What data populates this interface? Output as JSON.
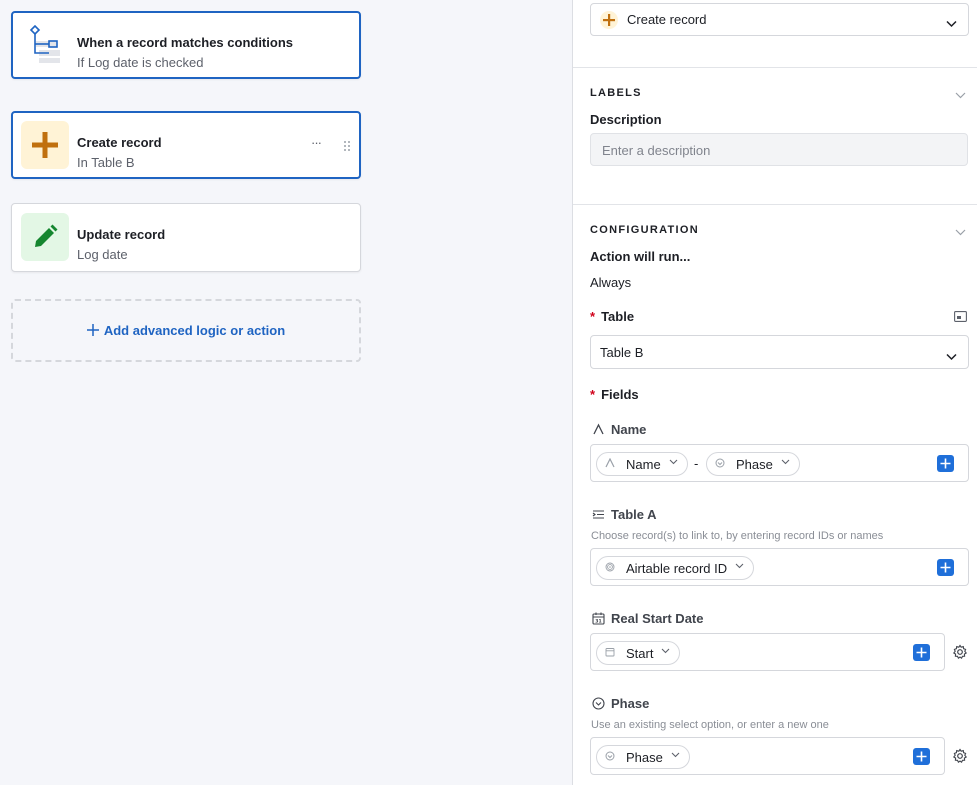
{
  "canvas": {
    "trigger": {
      "title": "When a record matches conditions",
      "subtitle": "If Log date is checked",
      "icon": "conditions-icon"
    },
    "actions": [
      {
        "title": "Create record",
        "subtitle": "In Table B",
        "icon": "plus-icon",
        "more": "···"
      },
      {
        "title": "Update record",
        "subtitle": "Log date",
        "icon": "pencil-icon"
      }
    ],
    "add_label": "Add advanced logic or action"
  },
  "panel": {
    "action_select": {
      "value": "Create record"
    },
    "labels": {
      "section_title": "LABELS",
      "description_label": "Description",
      "description_placeholder": "Enter a description"
    },
    "configuration": {
      "section_title": "CONFIGURATION",
      "run_label": "Action will run...",
      "run_value": "Always",
      "table_label": "Table",
      "table_value": "Table B",
      "fields_label": "Fields",
      "required_mark": "*",
      "fields": [
        {
          "label": "Name",
          "icon": "text-field-icon",
          "tokens": [
            "Name",
            "Phase"
          ],
          "separator": "-"
        },
        {
          "label": "Table A",
          "icon": "link-field-icon",
          "hint": "Choose record(s) to link to, by entering record IDs or names",
          "tokens": [
            "Airtable record ID"
          ]
        },
        {
          "label": "Real Start Date",
          "icon": "calendar-icon",
          "tokens": [
            "Start"
          ]
        },
        {
          "label": "Phase",
          "icon": "select-field-icon",
          "hint": "Use an existing select option, or enter a new one",
          "tokens": [
            "Phase"
          ]
        }
      ]
    }
  },
  "colors": {
    "accent": "#1f64c2",
    "add_button": "#1f6fd9",
    "plus_icon": "#c0700f",
    "plus_bg": "#fff3d6",
    "pencil_icon": "#15862f",
    "pencil_bg": "#e3f7e5"
  }
}
